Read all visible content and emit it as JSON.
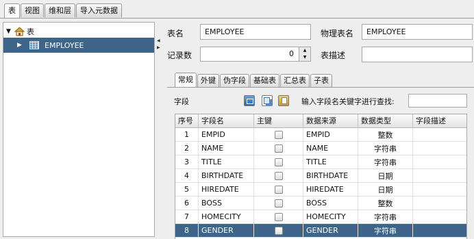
{
  "top_tabs": [
    "表",
    "视图",
    "维和层",
    "导入元数据"
  ],
  "tree": {
    "root_label": "表",
    "child_label": "EMPLOYEE"
  },
  "form": {
    "table_name_label": "表名",
    "table_name_value": "EMPLOYEE",
    "physical_name_label": "物理表名",
    "physical_name_value": "EMPLOYEE",
    "record_count_label": "记录数",
    "record_count_value": "0",
    "table_desc_label": "表描述",
    "table_desc_value": ""
  },
  "sub_tabs": [
    "常规",
    "外键",
    "伪字段",
    "基础表",
    "汇总表",
    "子表"
  ],
  "fields_section": {
    "label": "字段",
    "search_label": "输入字段名关键字进行查找:",
    "search_value": ""
  },
  "grid": {
    "headers": [
      "序号",
      "字段名",
      "主键",
      "数据来源",
      "数据类型",
      "字段描述"
    ],
    "rows": [
      {
        "no": "1",
        "name": "EMPID",
        "source": "EMPID",
        "type": "整数",
        "desc": ""
      },
      {
        "no": "2",
        "name": "NAME",
        "source": "NAME",
        "type": "字符串",
        "desc": ""
      },
      {
        "no": "3",
        "name": "TITLE",
        "source": "TITLE",
        "type": "字符串",
        "desc": ""
      },
      {
        "no": "4",
        "name": "BIRTHDATE",
        "source": "BIRTHDATE",
        "type": "日期",
        "desc": ""
      },
      {
        "no": "5",
        "name": "HIREDATE",
        "source": "HIREDATE",
        "type": "日期",
        "desc": ""
      },
      {
        "no": "6",
        "name": "BOSS",
        "source": "BOSS",
        "type": "整数",
        "desc": ""
      },
      {
        "no": "7",
        "name": "HOMECITY",
        "source": "HOMECITY",
        "type": "字符串",
        "desc": ""
      },
      {
        "no": "8",
        "name": "GENDER",
        "source": "GENDER",
        "type": "字符串",
        "desc": ""
      }
    ],
    "selected_row": 8
  },
  "colors": {
    "selection": "#3d6589",
    "panel_bg": "#eeeeee"
  }
}
